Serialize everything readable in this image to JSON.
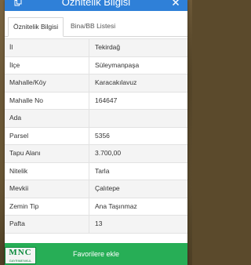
{
  "header": {
    "title": "Öznitelik Bilgisi",
    "left_icon": "copy-icon",
    "right_icon": "close-icon"
  },
  "tabs": [
    {
      "label": "Öznitelik Bilgisi",
      "active": true
    },
    {
      "label": "Bina/BB Listesi",
      "active": false
    }
  ],
  "attributes": [
    {
      "key": "İl",
      "value": "Tekirdağ"
    },
    {
      "key": "İlçe",
      "value": "Süleymanpaşa"
    },
    {
      "key": "Mahalle/Köy",
      "value": "Karacakılavuz"
    },
    {
      "key": "Mahalle No",
      "value": "164647"
    },
    {
      "key": "Ada",
      "value": ""
    },
    {
      "key": "Parsel",
      "value": "5356"
    },
    {
      "key": "Tapu Alanı",
      "value": "3.700,00"
    },
    {
      "key": "Nitelik",
      "value": "Tarla"
    },
    {
      "key": "Mevkii",
      "value": "Çalıtepe"
    },
    {
      "key": "Zemin Tip",
      "value": "Ana Taşınmaz"
    },
    {
      "key": "Pafta",
      "value": "13"
    }
  ],
  "favorite_button": "Favorilere ekle",
  "logo": {
    "main": "MNC",
    "sub": "GAYRIMENKUL"
  },
  "colors": {
    "header": "#2f80d8",
    "button": "#27ae56",
    "logo": "#0c8a3c"
  }
}
